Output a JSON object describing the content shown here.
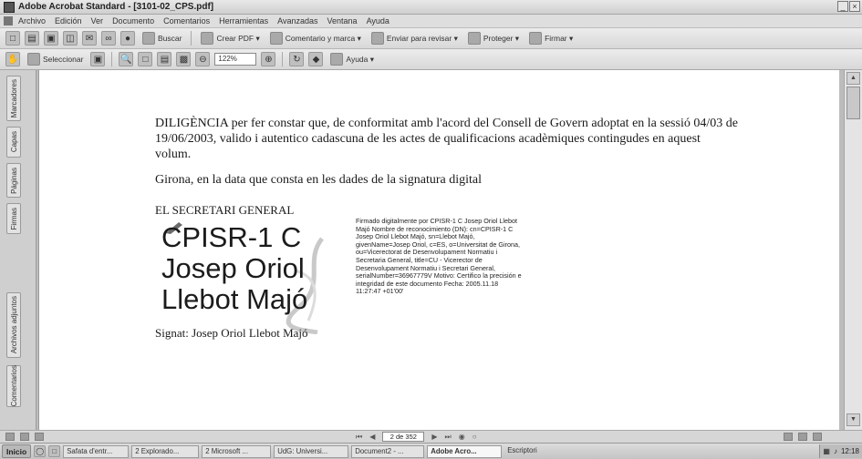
{
  "window": {
    "title": "Adobe Acrobat Standard - [3101-02_CPS.pdf]",
    "controls": [
      "_",
      "×"
    ]
  },
  "menu": [
    "Archivo",
    "Edición",
    "Ver",
    "Documento",
    "Comentarios",
    "Herramientas",
    "Avanzadas",
    "Ventana",
    "Ayuda"
  ],
  "toolbar1": {
    "search_label": "Buscar",
    "create_pdf_label": "Crear PDF ▾",
    "comment_label": "Comentario y marca ▾",
    "send_review_label": "Enviar para revisar ▾",
    "protect_label": "Proteger ▾",
    "sign_label": "Firmar ▾"
  },
  "toolbar2": {
    "select_label": "Seleccionar",
    "zoom_value": "122%",
    "help_label": "Ayuda ▾"
  },
  "side_tabs": [
    "Marcadores",
    "Capas",
    "Páginas",
    "Firmas",
    "Archivos adjuntos",
    "Comentarios"
  ],
  "document": {
    "diligencia": "DILIGÈNCIA per fer constar que, de conformitat amb l'acord del Consell de Govern adoptat en la sessió 04/03 de 19/06/2003, valido i autentico cadascuna de les actes de qualificacions acadèmiques contingudes en aquest volum.",
    "girona": "Girona, en la data que consta en les dades de la signatura digital",
    "secretari": "EL SECRETARI GENERAL",
    "sig_line1": "CPISR-1 C",
    "sig_line2": "Josep Oriol",
    "sig_line3": "Llebot Majó",
    "sig_details": "Firmado digitalmente por CPISR-1 C Josep Oriol Llebot Majó Nombre de reconocimiento (DN): cn=CPISR-1 C Josep Oriol Llebot Majó, sn=Llebot Majó, givenName=Josep Oriol, c=ES, o=Universitat de Girona, ou=Vicerectorat de Desenvolupament Normatiu i Secretaria General, title=CU - Vicerector de Desenvolupament Normatiu i Secretari General, serialNumber=36967779V Motivo: Certifico la precisión e integridad de este documento Fecha: 2005.11.18 11:27:47 +01'00'",
    "signat": "Signat: Josep Oriol Llebot Majó"
  },
  "statusbar": {
    "page_field": "2 de 352"
  },
  "taskbar": {
    "start_label": "Inicio",
    "tasks": [
      "Safata d'entr...",
      "2 Explorado...",
      "2 Microsoft ...",
      "UdG: Universi...",
      "Document2 - ...",
      "Adobe Acro..."
    ],
    "active_task": "Adobe Acro...",
    "desktop_label": "Escriptori",
    "clock": "12:18"
  }
}
